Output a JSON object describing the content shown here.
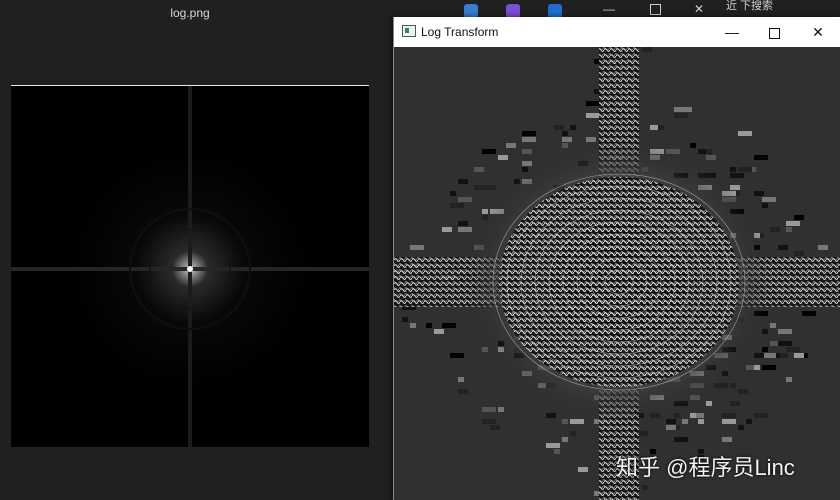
{
  "background_window": {
    "title": "log.png"
  },
  "foreground_window": {
    "title": "Log Transform",
    "controls": {
      "minimize": "—",
      "maximize": "",
      "close": "✕"
    }
  },
  "background_controls": {
    "minimize": "—",
    "close": "✕"
  },
  "background_top_text": "近 下搜索",
  "watermark": "知乎 @程序员Linc",
  "colors": {
    "titlebar_bg": "#ffffff",
    "desktop_bg": "#202020",
    "canvas_bg": "#303030"
  },
  "icons": [
    "app-window-icon",
    "minimize-icon",
    "maximize-icon",
    "close-icon"
  ]
}
